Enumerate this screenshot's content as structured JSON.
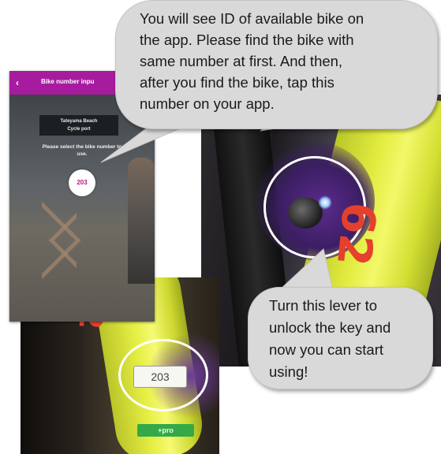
{
  "app_screen": {
    "header_title": "Bike number inpu",
    "station_name_line1": "Tateyama Beach",
    "station_name_line2": "Cycle port",
    "instruction_line1": "Please select the bike number to",
    "instruction_line2": "use.",
    "bike_id": "203",
    "accent_color": "#a71b9f"
  },
  "photo_fork": {
    "frame_number": "62"
  },
  "photo_plate": {
    "frame_number": "62",
    "id_sticker": "203",
    "green_label": "+pro"
  },
  "callouts": {
    "top": {
      "line1": "You will see ID of available bike on",
      "line2": "the app. Please find the bike with",
      "line3": "same number at first. And then,",
      "line4": "after you find the bike, tap this",
      "line5": "number on your app."
    },
    "bottom": {
      "line1": "Turn this lever to",
      "line2": "unlock the key and",
      "line3": "now you can start",
      "line4": "using!"
    }
  }
}
